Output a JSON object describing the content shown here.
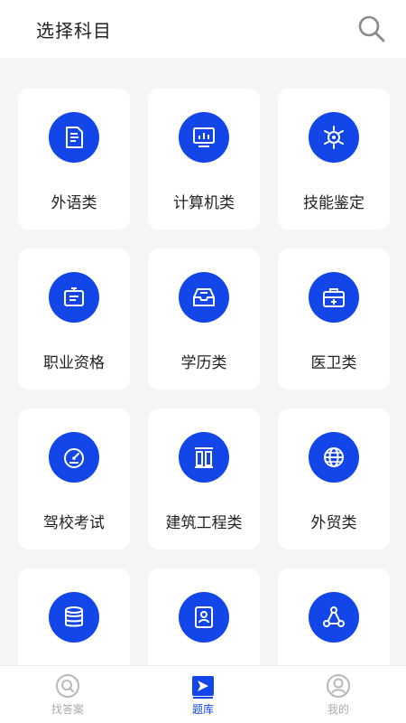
{
  "header": {
    "title": "选择科目",
    "search_icon": "search-icon"
  },
  "colors": {
    "accent": "#1346e8",
    "background": "#f5f5f7",
    "card": "#ffffff",
    "inactive": "#aaaaaa"
  },
  "categories": [
    {
      "label": "外语类",
      "icon": "document-icon"
    },
    {
      "label": "计算机类",
      "icon": "monitor-icon"
    },
    {
      "label": "技能鉴定",
      "icon": "skill-icon"
    },
    {
      "label": "职业资格",
      "icon": "badge-icon"
    },
    {
      "label": "学历类",
      "icon": "tray-icon"
    },
    {
      "label": "医卫类",
      "icon": "medical-kit-icon"
    },
    {
      "label": "驾校考试",
      "icon": "speedometer-icon"
    },
    {
      "label": "建筑工程类",
      "icon": "building-icon"
    },
    {
      "label": "外贸类",
      "icon": "globe-icon"
    },
    {
      "label": "",
      "icon": "database-icon"
    },
    {
      "label": "",
      "icon": "id-card-icon"
    },
    {
      "label": "",
      "icon": "share-icon"
    }
  ],
  "tabbar": {
    "items": [
      {
        "label": "找答案",
        "icon": "search-icon",
        "active": false
      },
      {
        "label": "题库",
        "icon": "play-flag-icon",
        "active": true
      },
      {
        "label": "我的",
        "icon": "user-icon",
        "active": false
      }
    ]
  }
}
